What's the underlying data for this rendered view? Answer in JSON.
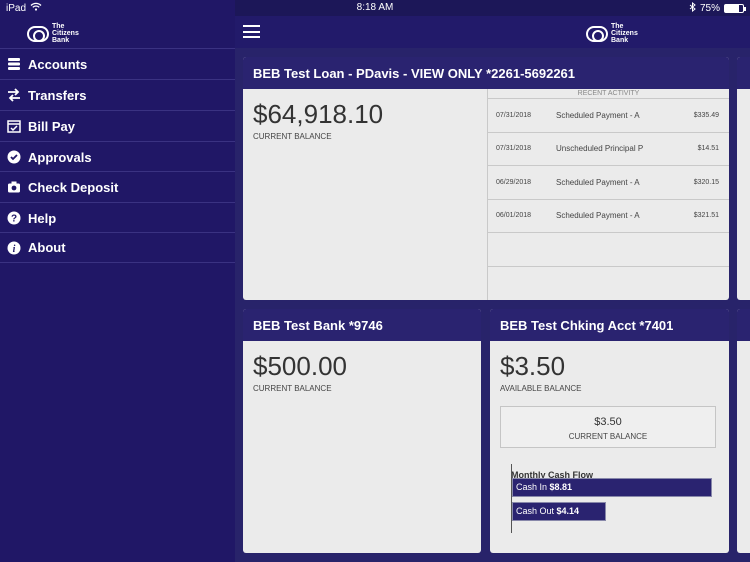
{
  "status_bar": {
    "device": "iPad",
    "time": "8:18 AM",
    "battery_percent": "75%",
    "battery_level": 0.75
  },
  "brand": {
    "logo_line1": "The",
    "logo_line2": "Citizens",
    "logo_line3": "Bank"
  },
  "sidebar": {
    "items": [
      {
        "label": "Accounts",
        "icon": "accounts-stack-icon"
      },
      {
        "label": "Transfers",
        "icon": "transfer-arrows-icon"
      },
      {
        "label": "Bill Pay",
        "icon": "calendar-check-icon"
      },
      {
        "label": "Approvals",
        "icon": "check-circle-icon"
      },
      {
        "label": "Check Deposit",
        "icon": "camera-icon"
      },
      {
        "label": "Help",
        "icon": "question-circle-icon"
      },
      {
        "label": "About",
        "icon": "info-circle-icon"
      }
    ]
  },
  "cards": {
    "loan": {
      "title": "BEB Test Loan - PDavis - VIEW ONLY *2261-5692261",
      "balance": "$64,918.10",
      "balance_label": "CURRENT BALANCE",
      "activity_title": "RECENT ACTIVITY",
      "activity": [
        {
          "date": "07/31/2018",
          "desc": "Scheduled Payment - A",
          "amount": "$335.49"
        },
        {
          "date": "07/31/2018",
          "desc": "Unscheduled Principal P",
          "amount": "$14.51"
        },
        {
          "date": "06/29/2018",
          "desc": "Scheduled Payment - A",
          "amount": "$320.15"
        },
        {
          "date": "06/01/2018",
          "desc": "Scheduled Payment - A",
          "amount": "$321.51"
        }
      ]
    },
    "bank": {
      "title": "BEB Test Bank *9746",
      "balance": "$500.00",
      "balance_label": "CURRENT BALANCE"
    },
    "checking": {
      "title": "BEB Test Chking Acct *7401",
      "balance": "$3.50",
      "balance_label": "AVAILABLE BALANCE",
      "current_balance": "$3.50",
      "current_balance_label": "CURRENT BALANCE",
      "cash_flow_title": "Monthly Cash Flow",
      "cash_in_label": "Cash In",
      "cash_in_value": "$8.81",
      "cash_out_label": "Cash Out",
      "cash_out_value": "$4.14"
    }
  },
  "colors": {
    "sidebar_bg": "#201766",
    "header_bg": "#2a2370",
    "card_bg": "#ebebeb"
  }
}
